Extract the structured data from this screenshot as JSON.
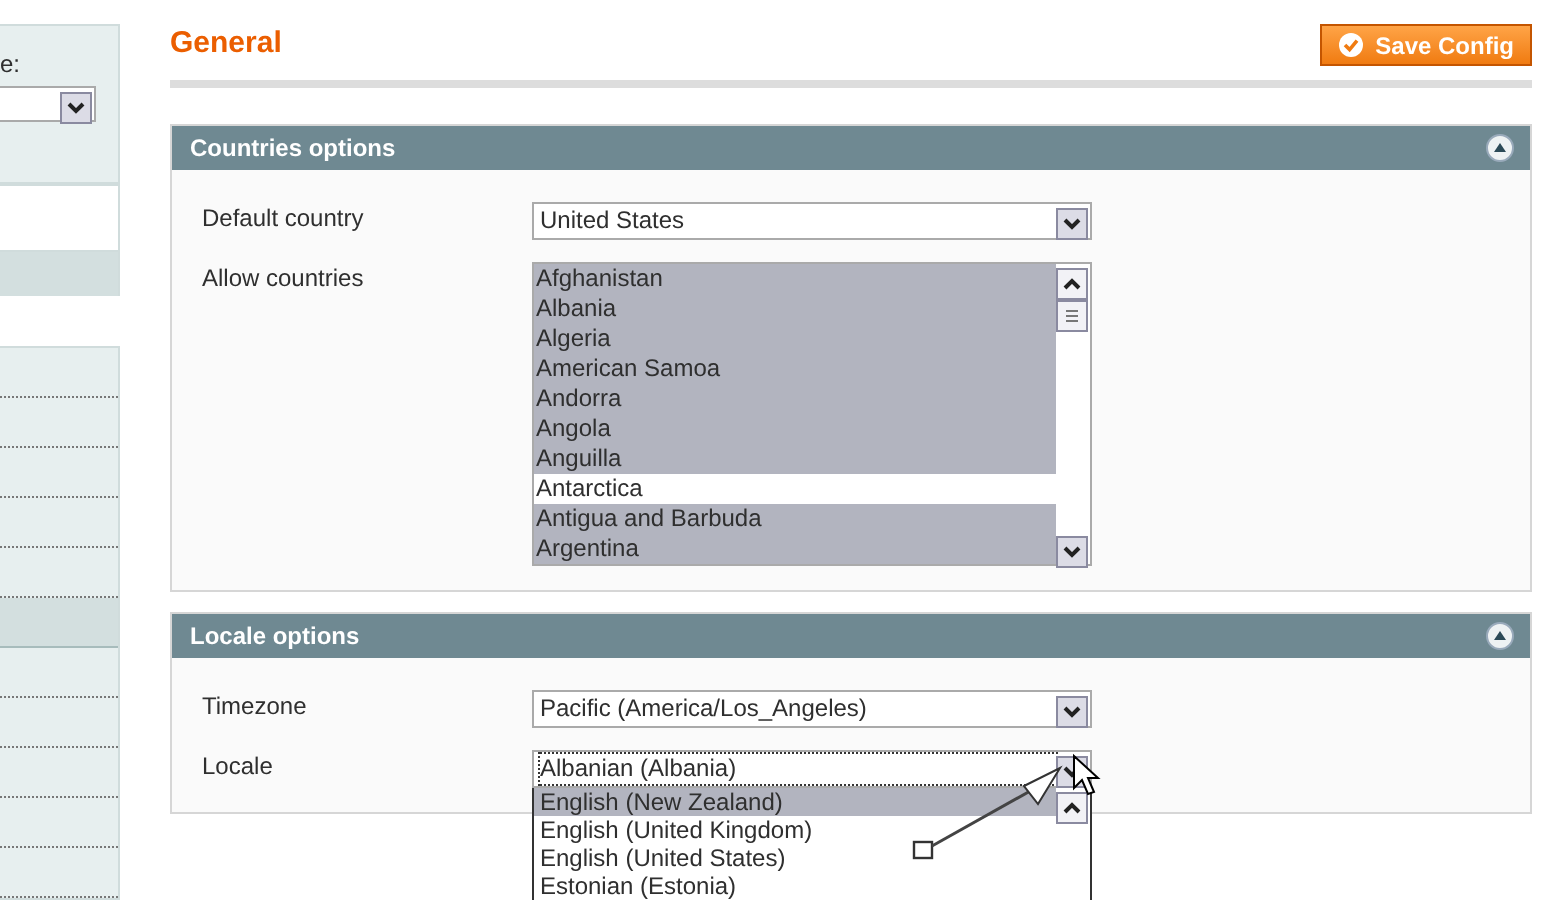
{
  "sidebar": {
    "label": "e:"
  },
  "page_title": "General",
  "save_button": "Save Config",
  "sections": [
    {
      "title": "Countries options",
      "expanded": true,
      "fields": [
        {
          "kind": "select",
          "label": "Default country",
          "value": "United States"
        },
        {
          "kind": "multiselect",
          "label": "Allow countries",
          "options": [
            {
              "label": "Afghanistan",
              "selected": true
            },
            {
              "label": "Albania",
              "selected": true
            },
            {
              "label": "Algeria",
              "selected": true
            },
            {
              "label": "American Samoa",
              "selected": true
            },
            {
              "label": "Andorra",
              "selected": true
            },
            {
              "label": "Angola",
              "selected": true
            },
            {
              "label": "Anguilla",
              "selected": true
            },
            {
              "label": "Antarctica",
              "selected": false
            },
            {
              "label": "Antigua and Barbuda",
              "selected": true
            },
            {
              "label": "Argentina",
              "selected": true
            }
          ]
        }
      ]
    },
    {
      "title": "Locale options",
      "expanded": true,
      "fields": [
        {
          "kind": "select",
          "label": "Timezone",
          "value": "Pacific (America/Los_Angeles)"
        },
        {
          "kind": "select",
          "label": "Locale",
          "value": "Albanian (Albania)",
          "focused": true,
          "open_options": [
            {
              "label": "English (New Zealand)",
              "selected": true
            },
            {
              "label": "English (United Kingdom)",
              "selected": false
            },
            {
              "label": "English (United States)",
              "selected": false
            },
            {
              "label": "Estonian (Estonia)",
              "selected": false
            }
          ]
        }
      ]
    }
  ]
}
